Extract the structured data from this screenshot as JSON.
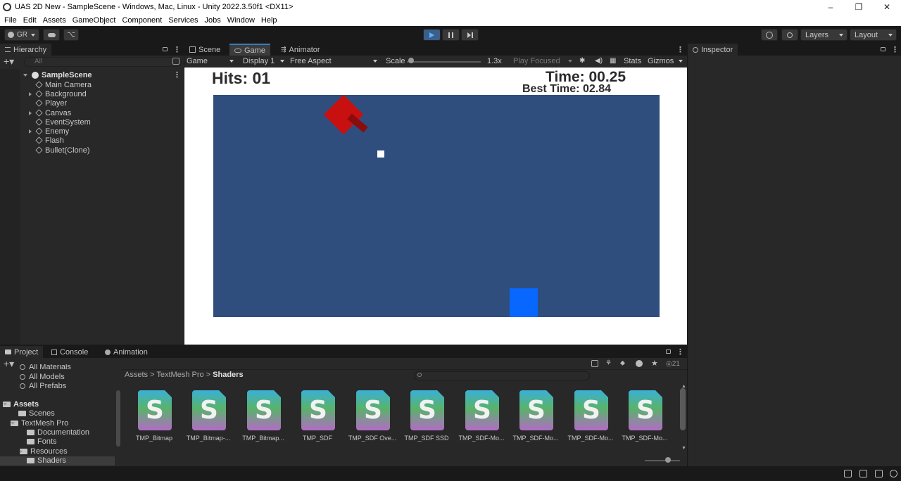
{
  "window": {
    "title": "UAS 2D New - SampleScene - Windows, Mac, Linux - Unity 2022.3.50f1 <DX11>",
    "controls": [
      "–",
      "❐",
      "✕"
    ]
  },
  "menu": [
    "File",
    "Edit",
    "Assets",
    "GameObject",
    "Component",
    "Services",
    "Jobs",
    "Window",
    "Help"
  ],
  "toolbar": {
    "account": "GR",
    "layers_label": "Layers",
    "layout_label": "Layout",
    "play_state": "playing"
  },
  "hierarchy": {
    "tab": "Hierarchy",
    "search_placeholder": "All",
    "scene": "SampleScene",
    "items": [
      {
        "label": "Main Camera",
        "expandable": false
      },
      {
        "label": "Background",
        "expandable": true
      },
      {
        "label": "Player",
        "expandable": false
      },
      {
        "label": "Canvas",
        "expandable": true
      },
      {
        "label": "EventSystem",
        "expandable": false
      },
      {
        "label": "Enemy",
        "expandable": true
      },
      {
        "label": "Flash",
        "expandable": false
      },
      {
        "label": "Bullet(Clone)",
        "expandable": false
      }
    ]
  },
  "game_view": {
    "tabs": [
      "Scene",
      "Game",
      "Animator"
    ],
    "active_tab": "Game",
    "view_mode": "Game",
    "display": "Display 1",
    "aspect": "Free Aspect",
    "scale_label": "Scale",
    "scale_value": "1.3x",
    "play_focused": "Play Focused",
    "stats": "Stats",
    "gizmos": "Gizmos",
    "hud": {
      "hits": "Hits: 01",
      "time": "Time: 00.25",
      "best_time": "Best Time: 02.84"
    },
    "colors": {
      "playfield": "#2f4e7d",
      "enemy": "#c81010",
      "player": "#0767ff",
      "bullet": "#ffffff"
    }
  },
  "inspector": {
    "tab": "Inspector"
  },
  "project": {
    "tabs": [
      "Project",
      "Console",
      "Animation"
    ],
    "hidden_count": "21",
    "favorites_partial": "All Materials",
    "favorites": [
      "All Models",
      "All Prefabs"
    ],
    "tree": [
      {
        "label": "Assets",
        "level": 0,
        "bold": true
      },
      {
        "label": "Scenes",
        "level": 1
      },
      {
        "label": "TextMesh Pro",
        "level": 1
      },
      {
        "label": "Documentation",
        "level": 2
      },
      {
        "label": "Fonts",
        "level": 2
      },
      {
        "label": "Resources",
        "level": 2
      },
      {
        "label": "Shaders",
        "level": 2,
        "selected": true
      }
    ],
    "breadcrumb": [
      "Assets",
      "TextMesh Pro",
      "Shaders"
    ],
    "assets": [
      {
        "icon_letter": "S",
        "name": "TMP_Bitmap"
      },
      {
        "icon_letter": "S",
        "name": "TMP_Bitmap-..."
      },
      {
        "icon_letter": "S",
        "name": "TMP_Bitmap..."
      },
      {
        "icon_letter": "S",
        "name": "TMP_SDF"
      },
      {
        "icon_letter": "S",
        "name": "TMP_SDF Ove..."
      },
      {
        "icon_letter": "S",
        "name": "TMP_SDF SSD"
      },
      {
        "icon_letter": "S",
        "name": "TMP_SDF-Mo..."
      },
      {
        "icon_letter": "S",
        "name": "TMP_SDF-Mo..."
      },
      {
        "icon_letter": "S",
        "name": "TMP_SDF-Mo..."
      },
      {
        "icon_letter": "S",
        "name": "TMP_SDF-Mo..."
      }
    ]
  }
}
